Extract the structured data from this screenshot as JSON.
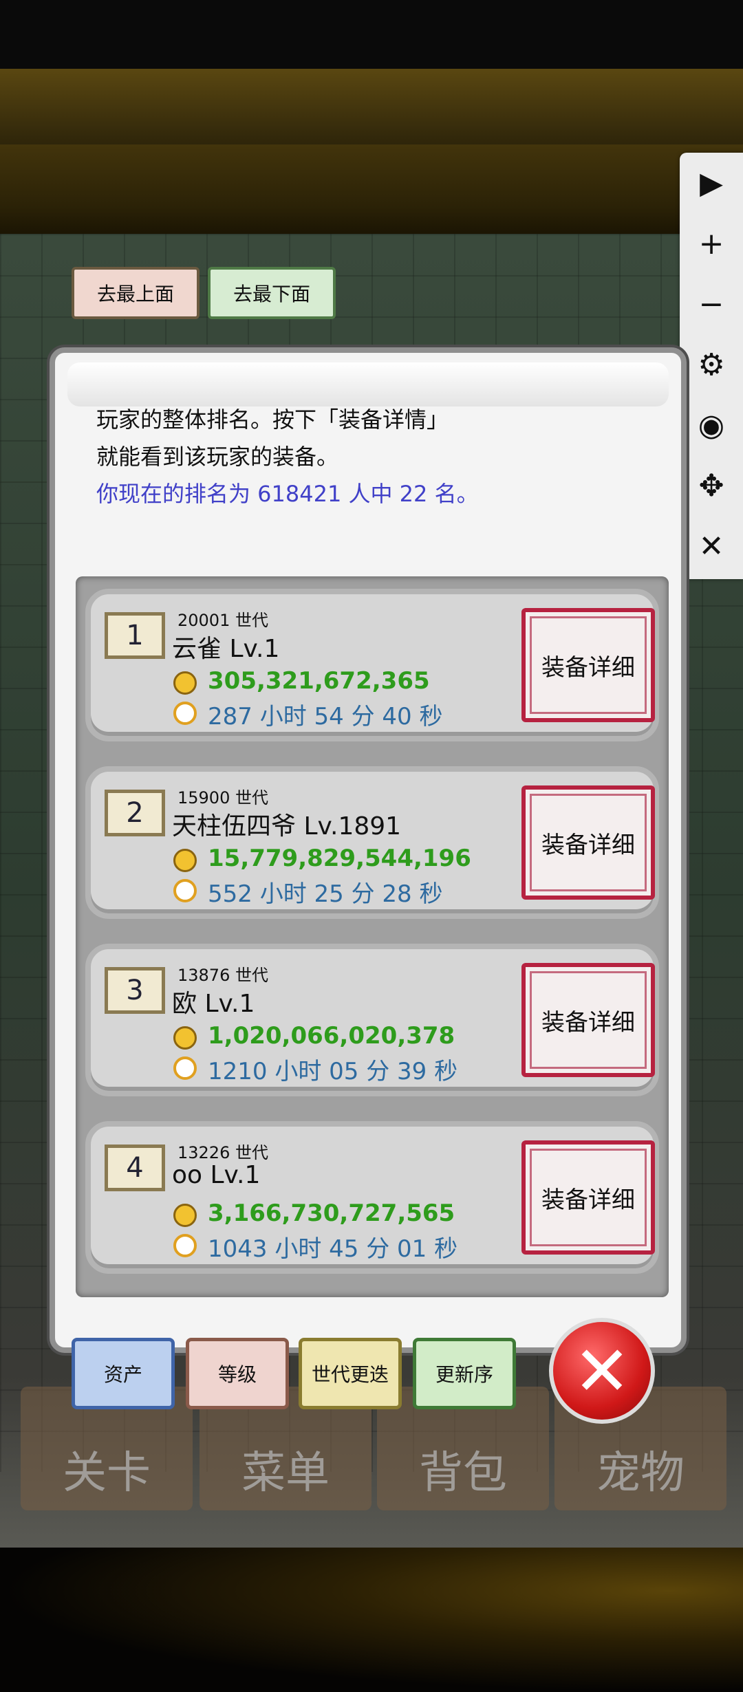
{
  "toolbar": {
    "items": [
      {
        "name": "play-icon",
        "glyph": "▶"
      },
      {
        "name": "plus-icon",
        "glyph": "+"
      },
      {
        "name": "minus-icon",
        "glyph": "−"
      },
      {
        "name": "gear-icon",
        "glyph": "⚙"
      },
      {
        "name": "eye-icon",
        "glyph": "◉"
      },
      {
        "name": "move-icon",
        "glyph": "✥"
      },
      {
        "name": "close-icon",
        "glyph": "✕"
      }
    ]
  },
  "nav": {
    "go_top": "去最上面",
    "go_bottom": "去最下面"
  },
  "dialog": {
    "intro_line1": "玩家的整体排名。按下「装备详情」",
    "intro_line2": "就能看到该玩家的装备。",
    "rank_line": "你现在的排名为 618421 人中 22 名。"
  },
  "rankings": [
    {
      "rank": "1",
      "generation": "20001 世代",
      "name": "云雀 Lv.1",
      "money": "305,321,672,365",
      "time": "287 小时 54 分 40 秒",
      "button": "装备详细"
    },
    {
      "rank": "2",
      "generation": "15900 世代",
      "name": "天柱伍四爷 Lv.1891",
      "money": "15,779,829,544,196",
      "time": "552 小时 25 分 28 秒",
      "button": "装备详细"
    },
    {
      "rank": "3",
      "generation": "13876 世代",
      "name": "欧 Lv.1",
      "money": "1,020,066,020,378",
      "time": "1210 小时 05 分 39 秒",
      "button": "装备详细"
    },
    {
      "rank": "4",
      "generation": "13226 世代",
      "name": "oo Lv.1",
      "money": "3,166,730,727,565",
      "time": "1043 小时 45 分 01 秒",
      "button": "装备详细"
    }
  ],
  "sort_buttons": {
    "assets": "资产",
    "level": "等级",
    "generation": "世代更迭",
    "refresh": "更新序"
  },
  "close_glyph": "✕",
  "bottom_tabs": {
    "stage": "关卡",
    "menu": "菜单",
    "bag": "背包",
    "pet": "宠物"
  }
}
